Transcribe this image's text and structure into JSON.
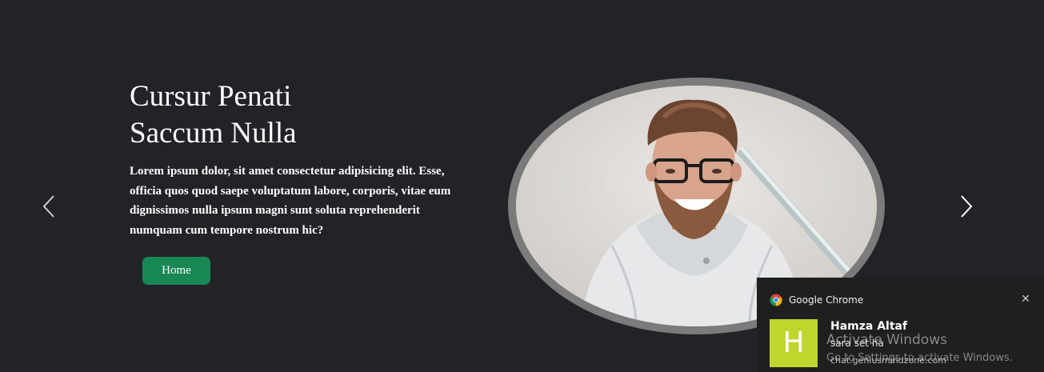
{
  "hero": {
    "title_line1": "Cursur Penati",
    "title_line2": "Saccum Nulla",
    "description": "Lorem ipsum dolor, sit amet consectetur adipisicing elit. Esse, officia quos quod saepe voluptatum labore, corporis, vitae eum dignissimos nulla ipsum magni sunt soluta reprehenderit numquam cum tempore nostrum hic?",
    "button_label": "Home",
    "button_color": "#198754",
    "background_color": "#212327"
  },
  "carousel": {
    "prev_icon": "chevron-left-icon",
    "next_icon": "chevron-right-icon"
  },
  "image": {
    "subject": "smiling-man-with-glasses-photo"
  },
  "notification": {
    "app_name": "Google Chrome",
    "app_icon": "chrome-icon",
    "close_icon": "close-icon",
    "avatar_letter": "H",
    "avatar_color": "#c0d62e",
    "sender": "Hamza Altaf",
    "message": "sara set ha",
    "site": "chat.geniusmindzone.com"
  },
  "watermark": {
    "title": "Activate Windows",
    "subtitle": "Go to Settings to activate Windows."
  }
}
